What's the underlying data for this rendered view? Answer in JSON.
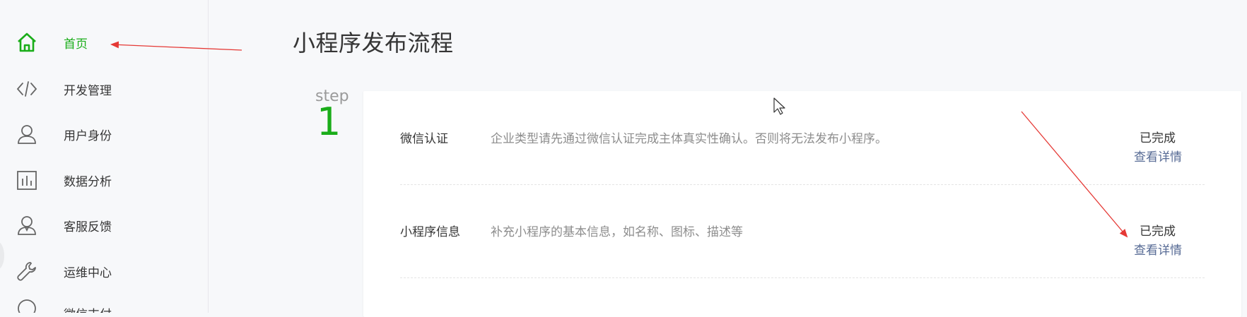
{
  "sidebar": {
    "items": [
      {
        "label": "首页",
        "icon": "home-icon",
        "active": true
      },
      {
        "label": "开发管理",
        "icon": "code-icon"
      },
      {
        "label": "用户身份",
        "icon": "user-icon"
      },
      {
        "label": "数据分析",
        "icon": "bar-chart-icon"
      },
      {
        "label": "客服反馈",
        "icon": "service-user-icon"
      },
      {
        "label": "运维中心",
        "icon": "wrench-icon"
      },
      {
        "label": "微信支付",
        "icon": "wechat-pay-icon"
      }
    ]
  },
  "main": {
    "title": "小程序发布流程",
    "step": {
      "label": "step",
      "number": "1"
    },
    "rows": [
      {
        "title": "微信认证",
        "description": "企业类型请先通过微信认证完成主体真实性确认。否则将无法发布小程序。",
        "status": "已完成",
        "link": "查看详情"
      },
      {
        "title": "小程序信息",
        "description": "补充小程序的基本信息，如名称、图标、描述等",
        "status": "已完成",
        "link": "查看详情"
      }
    ]
  },
  "colors": {
    "accent": "#1aad19",
    "link": "#576b95",
    "annotation_arrow": "#e53935"
  }
}
